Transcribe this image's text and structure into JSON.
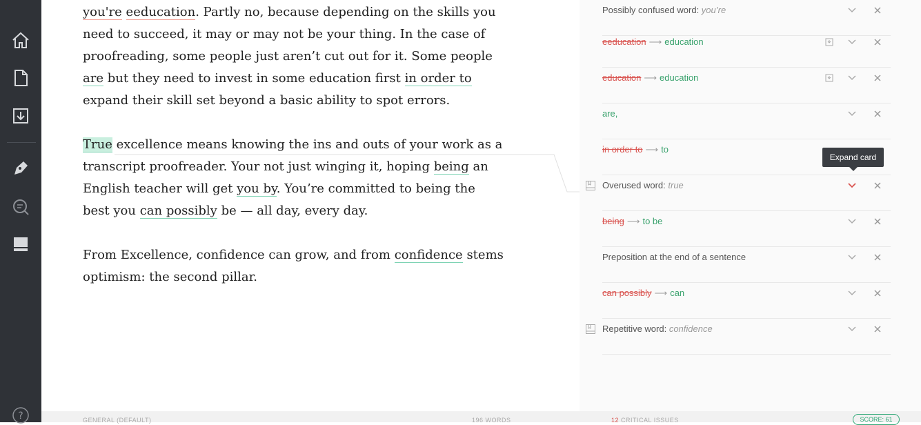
{
  "sidebar": {
    "icons": [
      "home-icon",
      "document-icon",
      "download-icon",
      "pen-icon",
      "search-icon",
      "book-icon",
      "help-icon"
    ],
    "help_label": "?"
  },
  "editor": {
    "p1": {
      "s1": "you're",
      "s2": " ",
      "s3": "eeducation",
      "s4": ". Partly no, because depending on the skills you need to succeed, it may or may not be your thing. In the case of proofreading, some people just aren’t cut out for it. Some people ",
      "s5": "are",
      "s6": " but they need to invest in some education first ",
      "s7": "in order to",
      "s8": " expand their skill set beyond a basic ability to spot errors."
    },
    "p2": {
      "s1": "True",
      "s2": " excellence means knowing the ins and outs of your work as a transcript proofreader. Your not just winging it, hoping ",
      "s3": "being",
      "s4": " an English teacher will get ",
      "s5": "you by",
      "s6": ". You’re committed to being the best you ",
      "s7": "can possibly",
      "s8": " be — all day, every day."
    },
    "p3": {
      "s1": "From Excellence, confidence can grow, and from ",
      "s2": "confidence",
      "s3": " stems optimism: the second pillar."
    }
  },
  "cards": [
    {
      "prefix": "Possibly confused word: ",
      "term": "you’re"
    },
    {
      "from": "eeducation",
      "to": "education"
    },
    {
      "from": "education",
      "to": "education"
    },
    {
      "fix": "are,"
    },
    {
      "from": "in order to",
      "to": "to"
    },
    {
      "prefix": "Overused word: ",
      "term": "true"
    },
    {
      "from": "being",
      "to": "to be"
    },
    {
      "text": "Preposition at the end of a sentence"
    },
    {
      "from": "can possibly",
      "to": "can"
    },
    {
      "prefix": "Repetitive word: ",
      "term": "confidence"
    }
  ],
  "arrow_glyph": "⟶",
  "tooltip": {
    "text": "Expand card"
  },
  "bottombar": {
    "doc_type": "GENERAL (DEFAULT)",
    "words": "196 WORDS",
    "issues_count": "12",
    "issues_label": " CRITICAL ISSUES",
    "score": "SCORE: 61"
  },
  "colors": {
    "sidebar": "#2f3237",
    "accent_green": "#3aa26d",
    "error_red": "#d9534f"
  }
}
